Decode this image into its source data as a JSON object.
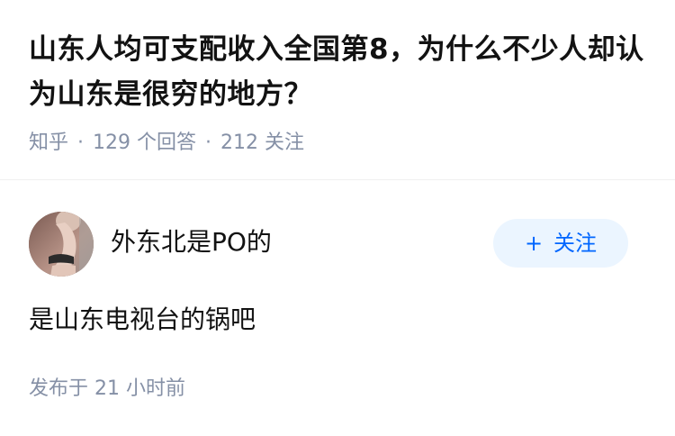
{
  "question": {
    "title": "山东人均可支配收入全国第8，为什么不少人却认为山东是很穷的地方？",
    "source": "知乎",
    "separator": "·",
    "answer_count": "129 个回答",
    "follower_count": "212 关注"
  },
  "answer": {
    "author_name": "外东北是PO的",
    "follow_icon": "plus-icon",
    "follow_label": "关注",
    "content": "是山东电视台的锅吧",
    "published_label": "发布于",
    "published_time": "21 小时前"
  },
  "colors": {
    "text_primary": "#121212",
    "text_secondary": "#8590a6",
    "follow_button_bg": "#ebf5ff",
    "follow_button_text": "#0066ff",
    "divider": "#f0f0f0"
  }
}
